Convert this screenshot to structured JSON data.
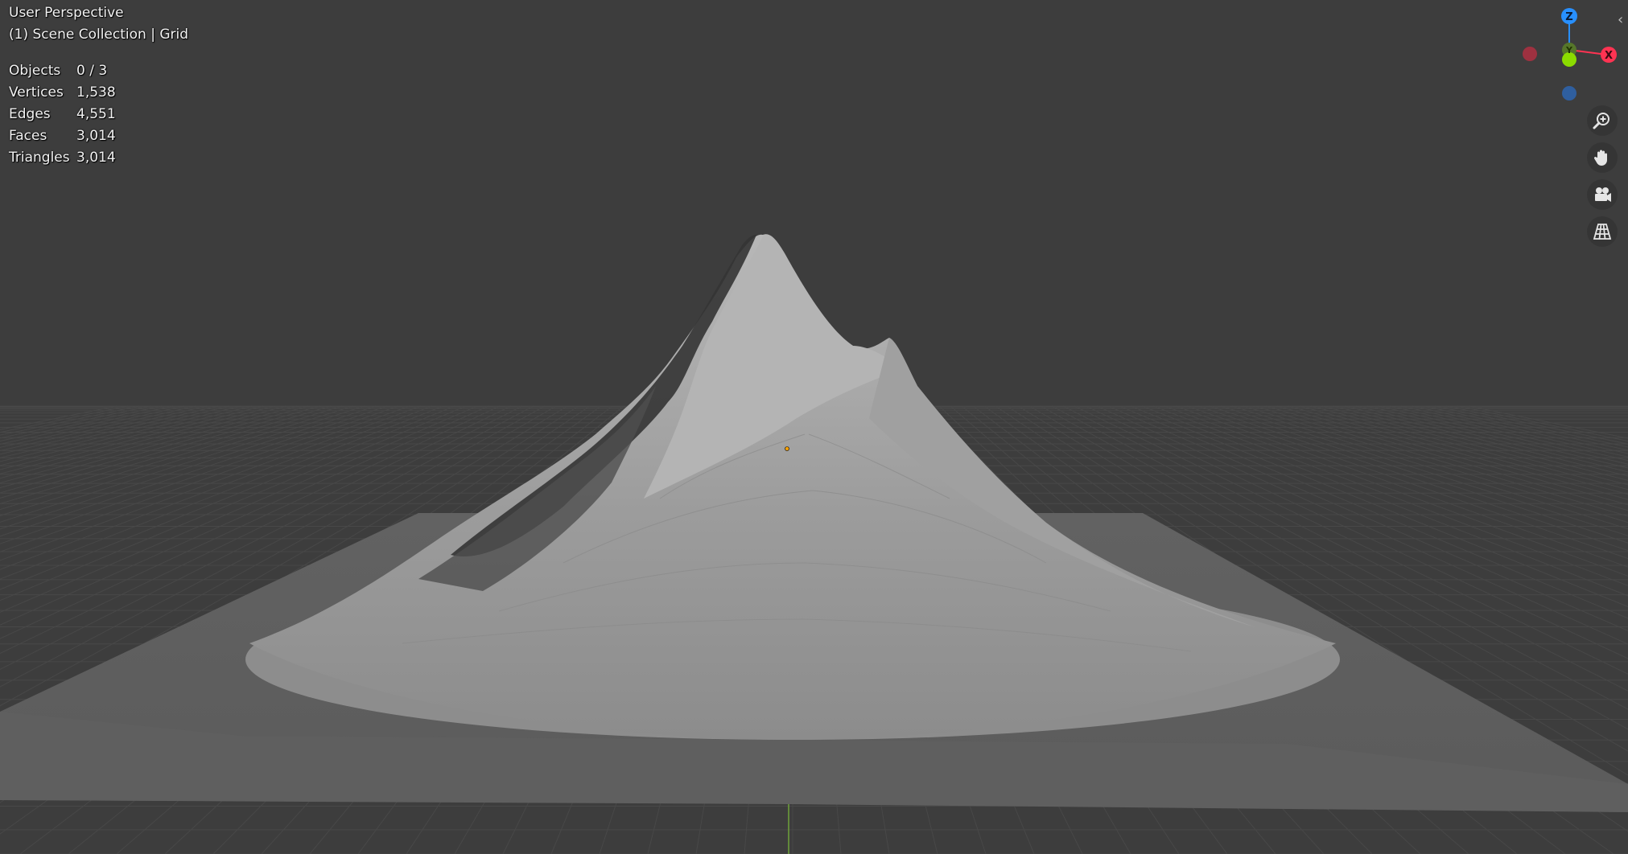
{
  "viewport": {
    "view_name": "User Perspective",
    "collection_info": "(1) Scene Collection | Grid"
  },
  "stats": [
    {
      "label": "Objects",
      "value": "0 / 3"
    },
    {
      "label": "Vertices",
      "value": "1,538"
    },
    {
      "label": "Edges",
      "value": "4,551"
    },
    {
      "label": "Faces",
      "value": "3,014"
    },
    {
      "label": "Triangles",
      "value": "3,014"
    }
  ],
  "gizmo": {
    "z_label": "Z",
    "y_label": "Y",
    "x_label": "X",
    "colors": {
      "x": "#ff3352",
      "y": "#8bdc00",
      "z": "#2890ff"
    }
  },
  "nav_buttons": {
    "zoom_icon": "zoom-in-icon",
    "pan_icon": "hand-icon",
    "camera_icon": "camera-icon",
    "ortho_icon": "grid-perspective-icon"
  },
  "colors": {
    "background": "#3d3d3d",
    "grid_line": "#4a4a4a",
    "plane": "#5a5a5a",
    "mountain_light": "#a4a4a4",
    "mountain_dark": "#2e2e2e",
    "origin": "#ffa200",
    "y_axis_line": "#6fa33a"
  }
}
